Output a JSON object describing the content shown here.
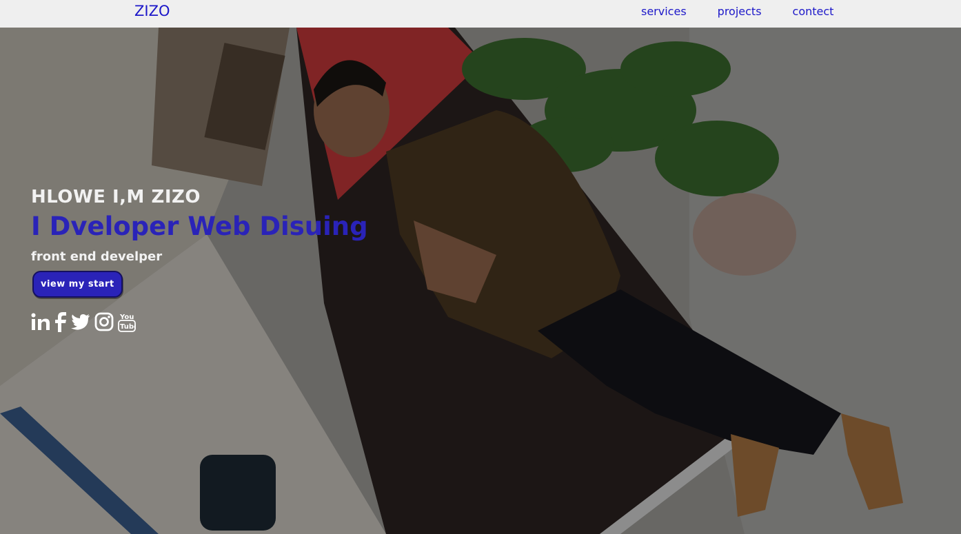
{
  "nav": {
    "brand": "ZIZO",
    "links": [
      "services",
      "projects",
      "contect"
    ]
  },
  "hero": {
    "greeting": "HLOWE I,M ZIZO",
    "headline": "I Dveloper Web Disuing",
    "subtitle": "front end develper",
    "cta_label": "view my start",
    "socials": [
      "linkedin-icon",
      "facebook-icon",
      "twitter-icon",
      "instagram-icon",
      "youtube-icon"
    ]
  },
  "colors": {
    "accent": "#2a23b8",
    "nav_link": "#1c17c9",
    "nav_bg": "#efefef",
    "overlay_text": "#f2f2f2"
  }
}
